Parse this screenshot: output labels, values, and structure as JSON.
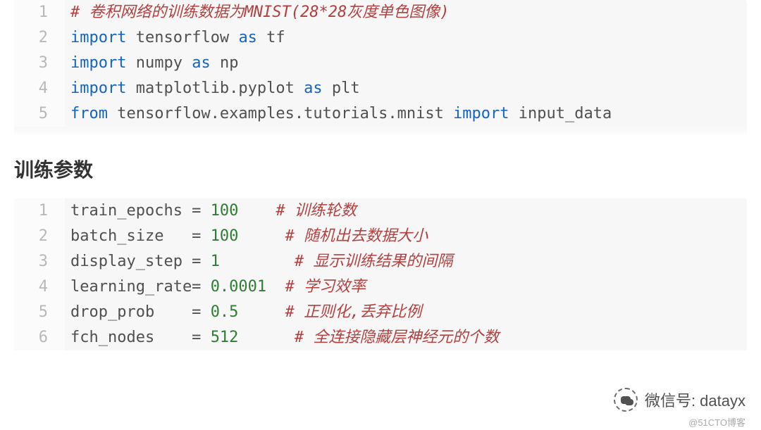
{
  "block1": {
    "lines": [
      {
        "n": "1",
        "segs": [
          {
            "cls": "comment",
            "t": "# 卷积网络的训练数据为MNIST(28*28灰度单色图像)"
          }
        ]
      },
      {
        "n": "2",
        "segs": [
          {
            "cls": "kw",
            "t": "import"
          },
          {
            "cls": "ident",
            "t": " tensorflow "
          },
          {
            "cls": "as",
            "t": "as"
          },
          {
            "cls": "ident",
            "t": " tf"
          }
        ]
      },
      {
        "n": "3",
        "segs": [
          {
            "cls": "kw",
            "t": "import"
          },
          {
            "cls": "ident",
            "t": " numpy "
          },
          {
            "cls": "as",
            "t": "as"
          },
          {
            "cls": "ident",
            "t": " np"
          }
        ]
      },
      {
        "n": "4",
        "segs": [
          {
            "cls": "kw",
            "t": "import"
          },
          {
            "cls": "ident",
            "t": " matplotlib.pyplot "
          },
          {
            "cls": "as",
            "t": "as"
          },
          {
            "cls": "ident",
            "t": " plt"
          }
        ]
      },
      {
        "n": "5",
        "segs": [
          {
            "cls": "kw",
            "t": "from"
          },
          {
            "cls": "ident",
            "t": " tensorflow.examples.tutorials.mnist "
          },
          {
            "cls": "kw",
            "t": "import"
          },
          {
            "cls": "ident",
            "t": " input_data"
          }
        ]
      }
    ]
  },
  "heading": "训练参数",
  "block2": {
    "lines": [
      {
        "n": "1",
        "segs": [
          {
            "cls": "ident",
            "t": "train_epochs = "
          },
          {
            "cls": "num",
            "t": "100"
          },
          {
            "cls": "ident",
            "t": "    "
          },
          {
            "cls": "comment",
            "t": "# 训练轮数"
          }
        ]
      },
      {
        "n": "2",
        "segs": [
          {
            "cls": "ident",
            "t": "batch_size   = "
          },
          {
            "cls": "num",
            "t": "100"
          },
          {
            "cls": "ident",
            "t": "     "
          },
          {
            "cls": "comment",
            "t": "# 随机出去数据大小"
          }
        ]
      },
      {
        "n": "3",
        "segs": [
          {
            "cls": "ident",
            "t": "display_step = "
          },
          {
            "cls": "num",
            "t": "1"
          },
          {
            "cls": "ident",
            "t": "        "
          },
          {
            "cls": "comment",
            "t": "# 显示训练结果的间隔"
          }
        ]
      },
      {
        "n": "4",
        "segs": [
          {
            "cls": "ident",
            "t": "learning_rate= "
          },
          {
            "cls": "num",
            "t": "0.0001"
          },
          {
            "cls": "ident",
            "t": "  "
          },
          {
            "cls": "comment",
            "t": "# 学习效率"
          }
        ]
      },
      {
        "n": "5",
        "segs": [
          {
            "cls": "ident",
            "t": "drop_prob    = "
          },
          {
            "cls": "num",
            "t": "0.5"
          },
          {
            "cls": "ident",
            "t": "     "
          },
          {
            "cls": "comment",
            "t": "# 正则化,丢弃比例"
          }
        ]
      },
      {
        "n": "6",
        "segs": [
          {
            "cls": "ident",
            "t": "fch_nodes    = "
          },
          {
            "cls": "num",
            "t": "512"
          },
          {
            "cls": "ident",
            "t": "      "
          },
          {
            "cls": "comment",
            "t": "# 全连接隐藏层神经元的个数"
          }
        ]
      }
    ]
  },
  "watermark": {
    "label": "微信号: datayx"
  },
  "attribution": "@51CTO博客"
}
